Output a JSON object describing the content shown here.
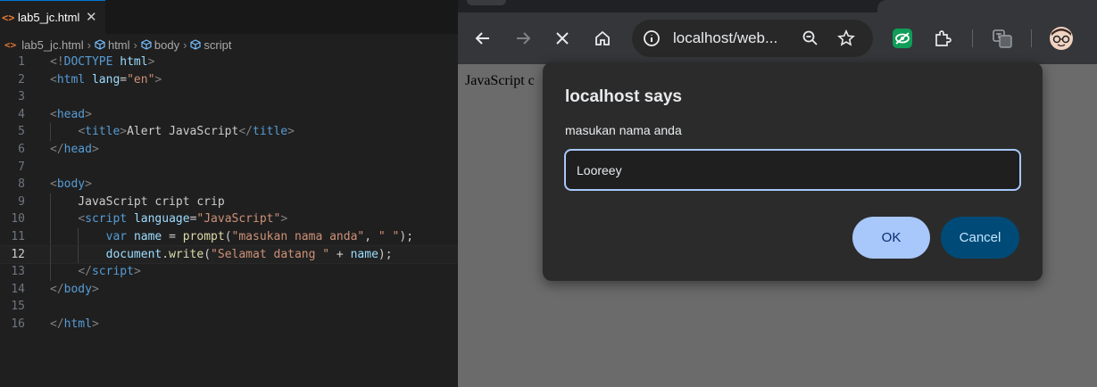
{
  "editor": {
    "tab": {
      "label": "lab5_jc.html",
      "close": "✕",
      "icon": "<>"
    },
    "breadcrumb": {
      "file": "lab5_jc.html",
      "items": [
        "html",
        "body",
        "script"
      ],
      "separator": "›"
    },
    "lines": [
      {
        "n": "1",
        "tokens": [
          [
            "t",
            "<!"
          ],
          [
            "tg",
            "DOCTYPE"
          ],
          [
            "tx",
            " "
          ],
          [
            "at",
            "html"
          ],
          [
            "t",
            ">"
          ]
        ]
      },
      {
        "n": "2",
        "tokens": [
          [
            "t",
            "<"
          ],
          [
            "tg",
            "html"
          ],
          [
            "tx",
            " "
          ],
          [
            "at",
            "lang"
          ],
          [
            "tx",
            "="
          ],
          [
            "st",
            "\"en\""
          ],
          [
            "t",
            ">"
          ]
        ]
      },
      {
        "n": "3",
        "tokens": []
      },
      {
        "n": "4",
        "tokens": [
          [
            "t",
            "<"
          ],
          [
            "tg",
            "head"
          ],
          [
            "t",
            ">"
          ]
        ]
      },
      {
        "n": "5",
        "tokens": [
          [
            "tx",
            "    "
          ],
          [
            "t",
            "<"
          ],
          [
            "tg",
            "title"
          ],
          [
            "t",
            ">"
          ],
          [
            "tx",
            "Alert JavaScript"
          ],
          [
            "t",
            "</"
          ],
          [
            "tg",
            "title"
          ],
          [
            "t",
            ">"
          ]
        ]
      },
      {
        "n": "6",
        "tokens": [
          [
            "t",
            "</"
          ],
          [
            "tg",
            "head"
          ],
          [
            "t",
            ">"
          ]
        ]
      },
      {
        "n": "7",
        "tokens": []
      },
      {
        "n": "8",
        "tokens": [
          [
            "t",
            "<"
          ],
          [
            "tg",
            "body"
          ],
          [
            "t",
            ">"
          ]
        ]
      },
      {
        "n": "9",
        "tokens": [
          [
            "tx",
            "    JavaScript cript crip"
          ]
        ]
      },
      {
        "n": "10",
        "tokens": [
          [
            "tx",
            "    "
          ],
          [
            "t",
            "<"
          ],
          [
            "tg",
            "script"
          ],
          [
            "tx",
            " "
          ],
          [
            "at",
            "language"
          ],
          [
            "tx",
            "="
          ],
          [
            "st",
            "\"JavaScript\""
          ],
          [
            "t",
            ">"
          ]
        ]
      },
      {
        "n": "11",
        "tokens": [
          [
            "tx",
            "        "
          ],
          [
            "kw",
            "var"
          ],
          [
            "tx",
            " "
          ],
          [
            "vr",
            "name"
          ],
          [
            "tx",
            " = "
          ],
          [
            "fn",
            "prompt"
          ],
          [
            "tx",
            "("
          ],
          [
            "st",
            "\"masukan nama anda\""
          ],
          [
            "tx",
            ", "
          ],
          [
            "st",
            "\" \""
          ],
          [
            "tx",
            ");"
          ]
        ]
      },
      {
        "n": "12",
        "tokens": [
          [
            "tx",
            "        "
          ],
          [
            "vr",
            "document"
          ],
          [
            "tx",
            "."
          ],
          [
            "fn",
            "write"
          ],
          [
            "tx",
            "("
          ],
          [
            "st",
            "\"Selamat datang \""
          ],
          [
            "tx",
            " + "
          ],
          [
            "vr",
            "name"
          ],
          [
            "tx",
            ");"
          ]
        ],
        "active": true
      },
      {
        "n": "13",
        "tokens": [
          [
            "tx",
            "    "
          ],
          [
            "t",
            "</"
          ],
          [
            "tg",
            "script"
          ],
          [
            "t",
            ">"
          ]
        ]
      },
      {
        "n": "14",
        "tokens": [
          [
            "t",
            "</"
          ],
          [
            "tg",
            "body"
          ],
          [
            "t",
            ">"
          ]
        ]
      },
      {
        "n": "15",
        "tokens": []
      },
      {
        "n": "16",
        "tokens": [
          [
            "t",
            "</"
          ],
          [
            "tg",
            "html"
          ],
          [
            "t",
            ">"
          ]
        ]
      }
    ]
  },
  "browser": {
    "url": "localhost/web...",
    "page_text": "JavaScript c",
    "icons": [
      "back-icon",
      "forward-icon",
      "stop-icon",
      "home-icon",
      "site-info-icon",
      "zoom-icon",
      "bookmark-star-icon",
      "extension-green-icon",
      "extensions-puzzle-icon",
      "translate-icon",
      "profile-avatar-icon"
    ]
  },
  "dialog": {
    "title": "localhost says",
    "message": "masukan nama anda",
    "input_value": "Looreey",
    "ok_label": "OK",
    "cancel_label": "Cancel"
  },
  "colors": {
    "accent": "#a8c7fa",
    "cancel_bg": "#004a77",
    "editor_bg": "#1f1f1f"
  }
}
